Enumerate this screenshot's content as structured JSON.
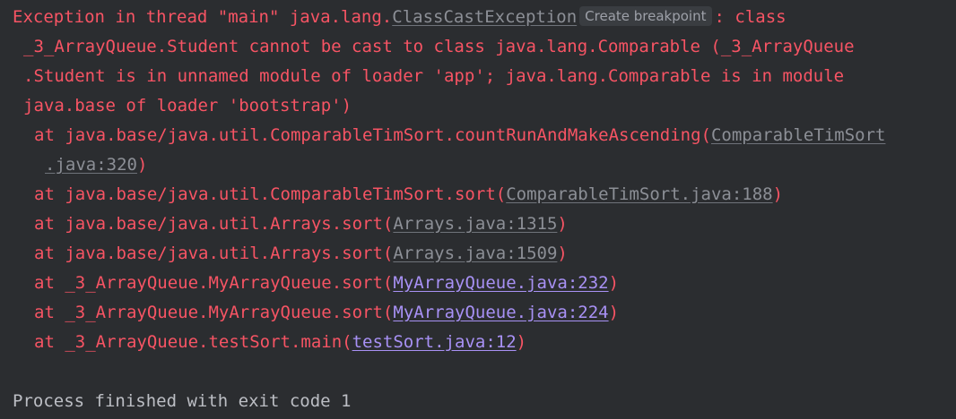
{
  "console": {
    "header": {
      "prefix": "Exception in thread \"main\" java.lang.",
      "exception_link": "ClassCastException",
      "breakpoint_hint": "Create breakpoint",
      "suffix": ": class",
      "msg_line2": "_3_ArrayQueue.Student cannot be cast to class java.lang.Comparable (_3_ArrayQueue",
      "msg_line3": ".Student is in unnamed module of loader 'app'; java.lang.Comparable is in module",
      "msg_line4": "java.base of loader 'bootstrap')"
    },
    "frames": [
      {
        "text": "at java.base/java.util.ComparableTimSort.countRunAndMakeAscending(",
        "link": "ComparableTimSort",
        "link_cont": ".java:320",
        "close": ")"
      },
      {
        "text": "at java.base/java.util.ComparableTimSort.sort(",
        "link": "ComparableTimSort.java:188",
        "close": ")"
      },
      {
        "text": "at java.base/java.util.Arrays.sort(",
        "link": "Arrays.java:1315",
        "close": ")"
      },
      {
        "text": "at java.base/java.util.Arrays.sort(",
        "link": "Arrays.java:1509",
        "close": ")"
      },
      {
        "text": "at _3_ArrayQueue.MyArrayQueue.sort(",
        "link": "MyArrayQueue.java:232",
        "close": ")"
      },
      {
        "text": "at _3_ArrayQueue.MyArrayQueue.sort(",
        "link": "MyArrayQueue.java:224",
        "close": ")"
      },
      {
        "text": "at _3_ArrayQueue.testSort.main(",
        "link": "testSort.java:12",
        "close": ")"
      }
    ],
    "exit_message": "Process finished with exit code 1",
    "colors": {
      "background": "#2b2d30",
      "error_text": "#f75464",
      "library_link": "#8c8f96",
      "user_link": "#a891f5",
      "plain_text": "#bcbec4"
    }
  }
}
